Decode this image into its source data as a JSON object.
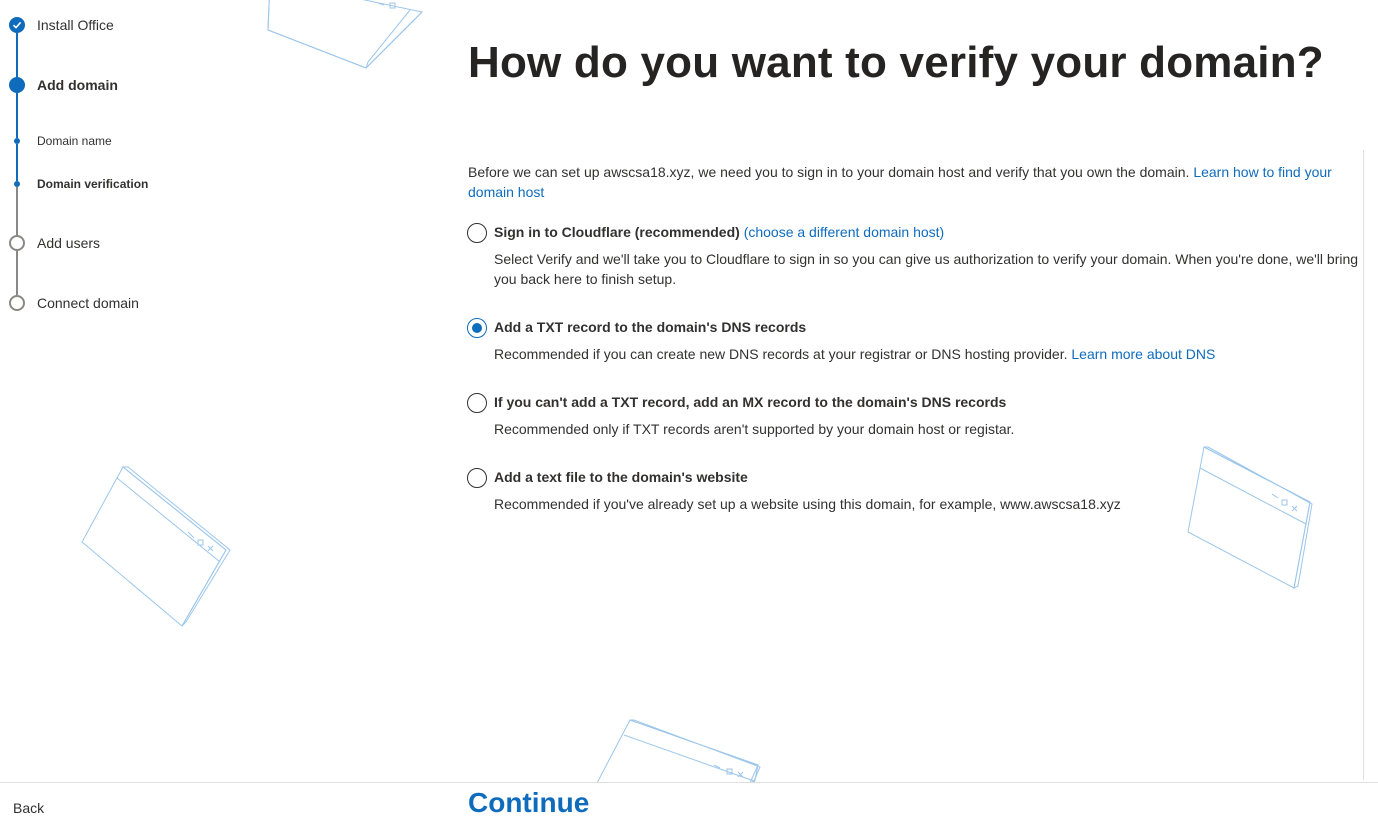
{
  "stepper": {
    "steps": [
      {
        "label": "Install Office",
        "state": "done"
      },
      {
        "label": "Add domain",
        "state": "current"
      },
      {
        "label": "Domain name",
        "state": "sub"
      },
      {
        "label": "Domain verification",
        "state": "sub-current"
      },
      {
        "label": "Add users",
        "state": "todo"
      },
      {
        "label": "Connect domain",
        "state": "todo"
      }
    ]
  },
  "main": {
    "title": "How do you want to verify your domain?",
    "intro_text": "Before we can set up awscsa18.xyz, we need you to sign in to your domain host and verify that you own the domain. ",
    "intro_link": "Learn how to find your domain host",
    "options": [
      {
        "title": "Sign in to Cloudflare (recommended)",
        "title_link": "(choose a different domain host)",
        "description": "Select Verify and we'll take you to Cloudflare to sign in so you can give us authorization to verify your domain. When you're done, we'll bring you back here to finish setup.",
        "selected": false
      },
      {
        "title": "Add a TXT record to the domain's DNS records",
        "description": "Recommended if you can create new DNS records at your registrar or DNS hosting provider. ",
        "description_link": "Learn more about DNS",
        "selected": true
      },
      {
        "title": "If you can't add a TXT record, add an MX record to the domain's DNS records",
        "description": "Recommended only if TXT records aren't supported by your domain host or registar.",
        "selected": false
      },
      {
        "title": "Add a text file to the domain's website",
        "description": "Recommended if you've already set up a website using this domain, for example, www.awscsa18.xyz",
        "selected": false
      }
    ]
  },
  "footer": {
    "back_label": "Back",
    "continue_label": "Continue"
  },
  "colors": {
    "accent": "#0f6cbd",
    "text": "#323130",
    "muted": "#8a8886"
  },
  "icons": [
    "checkmark-icon",
    "window-illustration"
  ]
}
